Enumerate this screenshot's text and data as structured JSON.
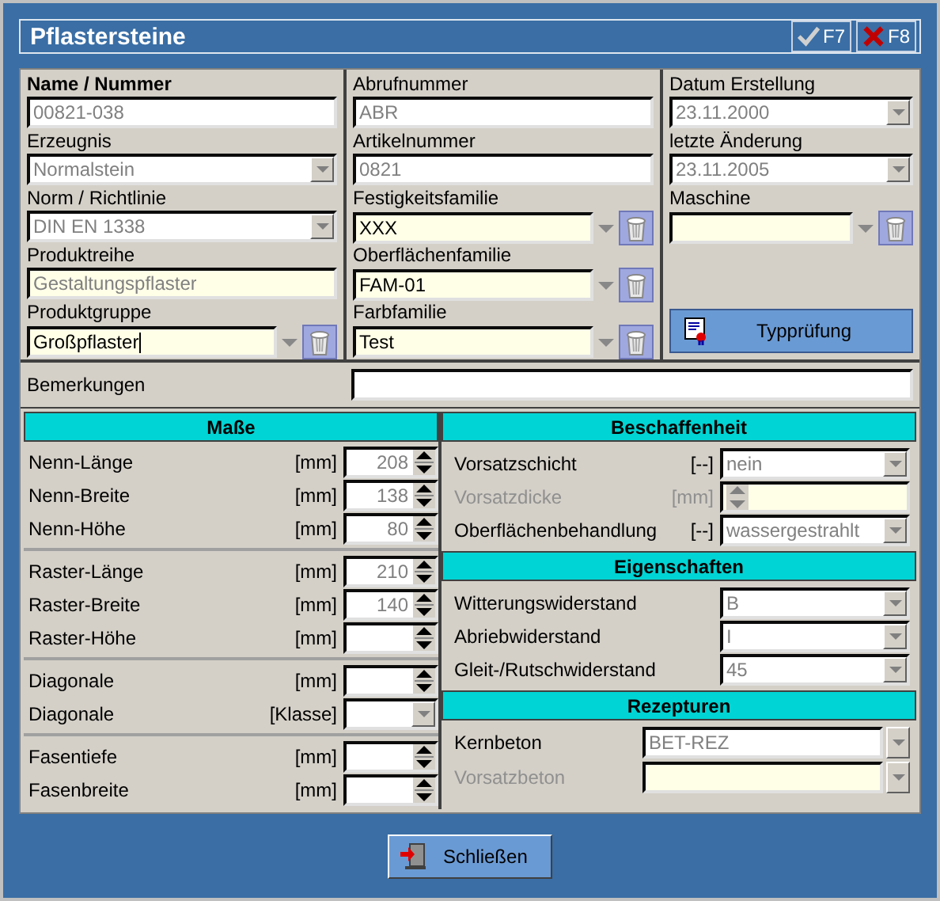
{
  "window": {
    "title": "Pflastersteine"
  },
  "title_buttons": [
    {
      "kind": "confirm",
      "label": "F7"
    },
    {
      "kind": "cancel",
      "label": "F8"
    }
  ],
  "header_columns": [
    {
      "fields": [
        {
          "label": "Name / Nummer",
          "bold": true,
          "kind": "text",
          "value": "00821-038",
          "readonly": true,
          "required": false,
          "focused": false
        },
        {
          "label": "Erzeugnis",
          "bold": false,
          "kind": "combo",
          "value": "Normalstein",
          "readonly": true,
          "required": false,
          "focused": false
        },
        {
          "label": "Norm / Richtlinie",
          "bold": false,
          "kind": "combo",
          "value": "DIN EN 1338",
          "readonly": true,
          "required": false,
          "focused": false
        },
        {
          "label": "Produktreihe",
          "bold": false,
          "kind": "text",
          "value": "Gestaltungspflaster",
          "readonly": true,
          "required": true,
          "focused": false
        },
        {
          "label": "Produktgruppe",
          "bold": false,
          "kind": "lookup",
          "value": "Großpflaster",
          "readonly": false,
          "required": true,
          "focused": true
        }
      ]
    },
    {
      "fields": [
        {
          "label": "Abrufnummer",
          "bold": false,
          "kind": "text",
          "value": "ABR",
          "readonly": true,
          "required": false,
          "focused": false
        },
        {
          "label": "Artikelnummer",
          "bold": false,
          "kind": "text",
          "value": "0821",
          "readonly": true,
          "required": false,
          "focused": false
        },
        {
          "label": "Festigkeitsfamilie",
          "bold": false,
          "kind": "lookup",
          "value": "XXX",
          "readonly": false,
          "required": true,
          "focused": false
        },
        {
          "label": "Oberflächenfamilie",
          "bold": false,
          "kind": "lookup",
          "value": "FAM-01",
          "readonly": false,
          "required": true,
          "focused": false
        },
        {
          "label": "Farbfamilie",
          "bold": false,
          "kind": "lookup",
          "value": "Test",
          "readonly": false,
          "required": true,
          "focused": false
        }
      ]
    },
    {
      "fields": [
        {
          "label": "Datum Erstellung",
          "bold": false,
          "kind": "combo",
          "value": "23.11.2000",
          "readonly": true,
          "required": false,
          "focused": false
        },
        {
          "label": "letzte Änderung",
          "bold": false,
          "kind": "combo",
          "value": "23.11.2005",
          "readonly": true,
          "required": false,
          "focused": false
        },
        {
          "label": "Maschine",
          "bold": false,
          "kind": "lookup",
          "readonly": false,
          "required": true,
          "focused": false
        }
      ],
      "button": "Typprüfung"
    }
  ],
  "remarks": {
    "label": "Bemerkungen"
  },
  "masse": {
    "title": "Maße",
    "groups": [
      [
        {
          "label": "Nenn-Länge",
          "unit": "[mm]",
          "value": "208",
          "kind": "spin",
          "readonly": true
        },
        {
          "label": "Nenn-Breite",
          "unit": "[mm]",
          "value": "138",
          "kind": "spin",
          "readonly": true
        },
        {
          "label": "Nenn-Höhe",
          "unit": "[mm]",
          "value": "80",
          "kind": "spin",
          "readonly": true
        }
      ],
      [
        {
          "label": "Raster-Länge",
          "unit": "[mm]",
          "value": "210",
          "kind": "spin",
          "readonly": true
        },
        {
          "label": "Raster-Breite",
          "unit": "[mm]",
          "value": "140",
          "kind": "spin",
          "readonly": true
        },
        {
          "label": "Raster-Höhe",
          "unit": "[mm]",
          "kind": "spin"
        }
      ],
      [
        {
          "label": "Diagonale",
          "unit": "[mm]",
          "kind": "spin"
        },
        {
          "label": "Diagonale",
          "unit": "[Klasse]",
          "kind": "combo"
        }
      ],
      [
        {
          "label": "Fasentiefe",
          "unit": "[mm]",
          "kind": "spin"
        },
        {
          "label": "Fasenbreite",
          "unit": "[mm]",
          "kind": "spin"
        }
      ]
    ]
  },
  "sections": [
    {
      "title": "Beschaffenheit",
      "rows": [
        {
          "label": "Vorsatzschicht",
          "unit": "[--]",
          "value": "nein",
          "kind": "combo",
          "disabled": false,
          "required": false
        },
        {
          "label": "Vorsatzdicke",
          "unit": "[mm]",
          "kind": "spin",
          "disabled": true,
          "required": true
        },
        {
          "label": "Oberflächenbehandlung",
          "unit": "[--]",
          "value": "wassergestrahlt",
          "kind": "combo",
          "disabled": false,
          "required": false
        }
      ]
    },
    {
      "title": "Eigenschaften",
      "rows": [
        {
          "label": "Witterungswiderstand",
          "value": "B",
          "kind": "combo",
          "disabled": false,
          "required": false
        },
        {
          "label": "Abriebwiderstand",
          "value": "I",
          "kind": "combo",
          "disabled": false,
          "required": false
        },
        {
          "label": "Gleit-/Rutschwiderstand",
          "value": "45",
          "kind": "combo",
          "disabled": false,
          "required": false
        }
      ]
    },
    {
      "title": "Rezepturen",
      "rows": [
        {
          "label": "Kernbeton",
          "value": "BET-REZ",
          "kind": "picker",
          "disabled": false,
          "required": false
        },
        {
          "label": "Vorsatzbeton",
          "kind": "picker",
          "disabled": true,
          "required": true
        }
      ]
    }
  ],
  "close_button": {
    "label": "Schließen"
  }
}
